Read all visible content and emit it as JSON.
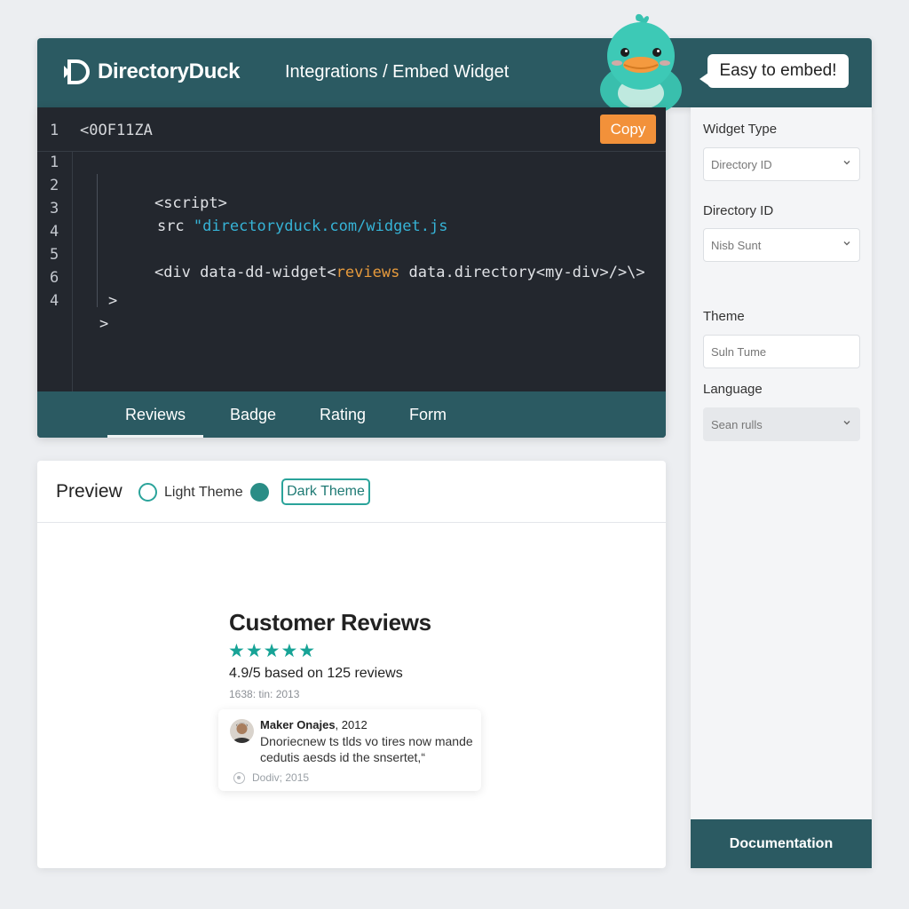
{
  "brand": {
    "name": "DirectoryDuck"
  },
  "header": {
    "breadcrumb": "Integrations / Embed Widget",
    "bubble": "Easy to embed!"
  },
  "code": {
    "header_line_number": "1",
    "header_text": "<0OF11ZA",
    "copy_label": "Copy",
    "line_numbers": [
      "1",
      "2",
      "3",
      "4",
      "5",
      "6",
      "4"
    ],
    "lines": {
      "script_open": "<script>",
      "src_prefix": "src ",
      "src_value": "\"directoryduck.com/widget.js",
      "div_prefix": "<div data-dd-widget<",
      "div_attr": "reviews",
      "div_suffix": " data.directory<my-div>/>\\>",
      "close_1": ">",
      "close_2": ">"
    }
  },
  "widget_tabs": [
    "Reviews",
    "Badge",
    "Rating",
    "Form"
  ],
  "active_widget_tab": "Reviews",
  "preview": {
    "title": "Preview",
    "light_label": "Light Theme",
    "dark_label": "Dark Theme",
    "selected_theme": "Dark Theme",
    "reviews_title": "Customer Reviews",
    "stars": "★★★★★",
    "star_count": 5,
    "rating_text": "4.9/5 based on 125 reviews",
    "rating_meta": "1638: tin: 2013",
    "review": {
      "reviewer": "Maker Onajes",
      "year": ", 2012",
      "body": "Dnoriecnew ts tlds vo tires now mande cedutis aesds id the snsertet,“",
      "footer": "Dodiv; 2015"
    }
  },
  "settings": {
    "widget_type_label": "Widget Type",
    "widget_type_value": "Directory ID",
    "directory_id_label": "Directory ID",
    "directory_id_value": "Nisb Sunt",
    "theme_label": "Theme",
    "theme_value": "Suln Tume",
    "language_label": "Language",
    "language_value": "Sean rulls",
    "documentation_label": "Documentation"
  },
  "colors": {
    "primary": "#2b5a62",
    "accent": "#f2913a",
    "teal": "#2aa39a",
    "code_bg": "#23272e",
    "string": "#36b3d6"
  },
  "icons": [
    "logo-icon",
    "duck-mascot-icon",
    "chevron-down-icon",
    "radio-icon",
    "star-icon",
    "avatar",
    "location-icon"
  ]
}
